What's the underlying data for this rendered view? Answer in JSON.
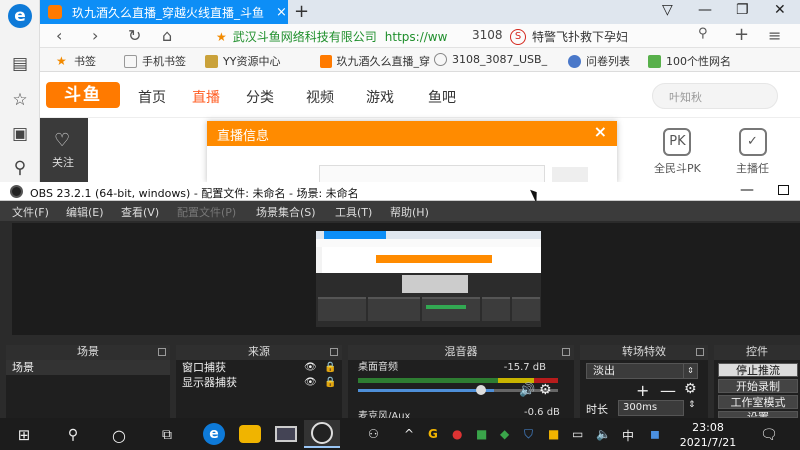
{
  "browser": {
    "tab_title": "玖九酒久么直播_穿越火线直播_斗鱼",
    "tab_close": "×",
    "new_tab": "+",
    "address_site": "武汉斗鱼网络科技有限公司",
    "address_url": "https://ww",
    "address_tab_number": "3108",
    "search_text": "特警飞扑救下孕妇",
    "bookmarks": [
      {
        "label": "书签",
        "color": "#f28a00"
      },
      {
        "label": "手机书签",
        "color": "#bbbbbb"
      },
      {
        "label": "YY资源中心",
        "color": "#caa23a"
      },
      {
        "label": "玖九酒久么直播_穿",
        "color": "#ff7a00"
      },
      {
        "label": "3108_3087_USB_",
        "color": "#888888"
      },
      {
        "label": "问卷列表",
        "color": "#4a78c9"
      },
      {
        "label": "100个性网名",
        "color": "#58b04b"
      }
    ]
  },
  "douyu": {
    "logo": "斗鱼",
    "nav": [
      "首页",
      "直播",
      "分类",
      "视频",
      "游戏",
      "鱼吧"
    ],
    "search_placeholder": "叶知秋",
    "follow": "关注",
    "features": [
      {
        "icon": "PK",
        "label": "全民斗PK"
      },
      {
        "icon": "✓",
        "label": "主播任"
      }
    ]
  },
  "dialog": {
    "title": "直播信息",
    "close": "×"
  },
  "obs": {
    "title": "OBS 23.2.1 (64-bit, windows) - 配置文件: 未命名 - 场景: 未命名",
    "menu": [
      "文件(F)",
      "编辑(E)",
      "查看(V)",
      "配置文件(P)",
      "场景集合(S)",
      "工具(T)",
      "帮助(H)"
    ],
    "docks": {
      "scenes": {
        "title": "场景",
        "items": [
          "场景"
        ]
      },
      "sources": {
        "title": "来源",
        "items": [
          "窗口捕获",
          "显示器捕获"
        ]
      },
      "mixer": {
        "title": "混音器",
        "track1": "桌面音频",
        "track1_db": "-15.7 dB",
        "track2": "麦克风/Aux",
        "track2_db": "-0.6 dB"
      },
      "transitions": {
        "title": "转场特效",
        "selected": "淡出",
        "duration_label": "时长",
        "duration": "300ms"
      },
      "controls": {
        "title": "控件",
        "buttons": [
          "停止推流",
          "开始录制",
          "工作室模式",
          "设置"
        ]
      }
    }
  },
  "taskbar": {
    "time": "23:08",
    "date": "2021/7/21",
    "ime": "中"
  }
}
